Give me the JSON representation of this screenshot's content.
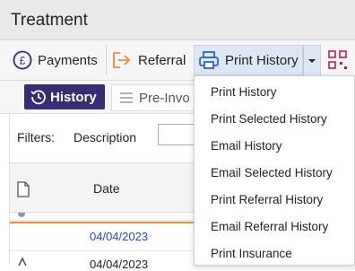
{
  "window": {
    "title": "Treatment"
  },
  "toolbar": {
    "payments_label": "Payments",
    "referral_label": "Referral",
    "print_history_label": "Print History"
  },
  "tabs": {
    "history_label": "History",
    "pre_invoice_label": "Pre-Invo"
  },
  "filters": {
    "label": "Filters:",
    "description_label": "Description",
    "description_value": ""
  },
  "table": {
    "columns": [
      "Date"
    ],
    "rows": [
      {
        "date": "04/04/2023"
      },
      {
        "date": "04/04/2023"
      }
    ]
  },
  "print_menu": {
    "items": [
      "Print History",
      "Print Selected History",
      "Email History",
      "Email Selected History",
      "Print Referral History",
      "Email Referral History",
      "Print Insurance"
    ]
  },
  "colors": {
    "accent_purple": "#3a2c72",
    "link_blue": "#1f4db8",
    "orange_divider": "#f08a3a",
    "print_blue": "#2c67b8"
  },
  "icons": [
    "pound-icon",
    "arrow-right-icon",
    "printer-icon",
    "chevron-down-icon",
    "grid-icon",
    "history-icon",
    "list-icon",
    "document-icon"
  ]
}
